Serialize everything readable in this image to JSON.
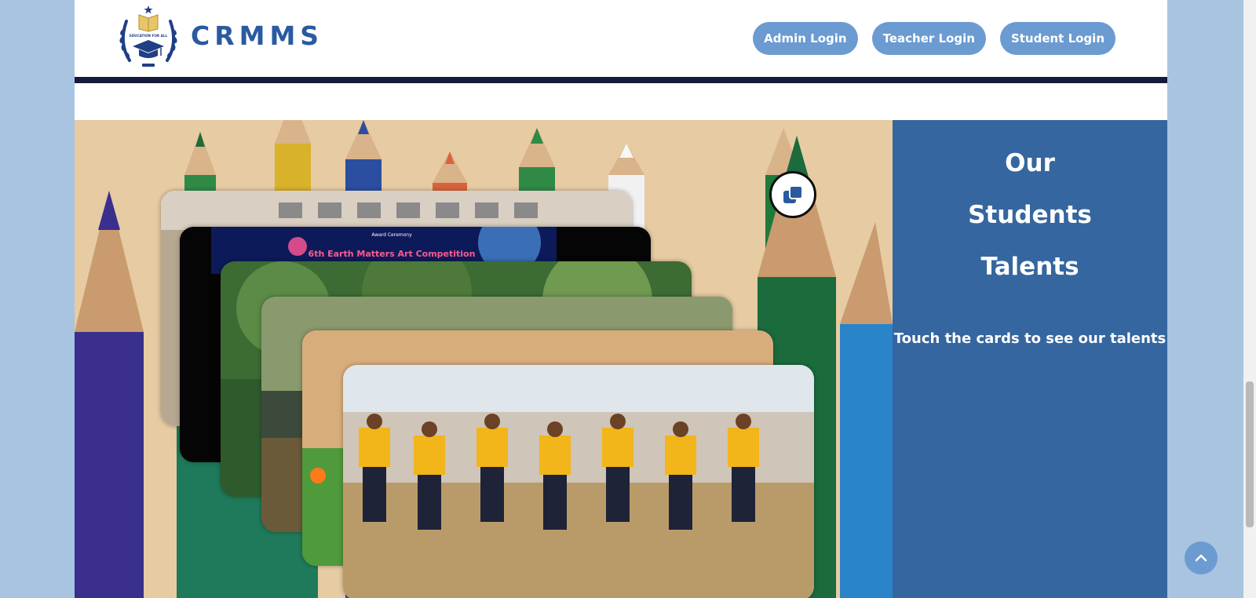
{
  "header": {
    "brand_name": "CRMMS",
    "logo_text": "EDUCATION FOR ALL",
    "nav_buttons": [
      {
        "label": "Admin Login"
      },
      {
        "label": "Teacher Login"
      },
      {
        "label": "Student Login"
      }
    ]
  },
  "talents": {
    "title_lines": [
      "Our",
      "Students",
      "Talents"
    ],
    "hint": "Touch the cards to see our talents",
    "cards": [
      {
        "name": "school-building-photo"
      },
      {
        "name": "award-ceremony-photo",
        "caption_top": "Award Ceremony",
        "caption": "6th Earth Matters Art Competition"
      },
      {
        "name": "garden-photo"
      },
      {
        "name": "painting-photo"
      },
      {
        "name": "football-photo"
      },
      {
        "name": "drill-exercise-photo"
      }
    ]
  },
  "colors": {
    "page_background": "#a8c4e0",
    "brand_blue": "#2a5aa0",
    "nav_button": "#6b9bd1",
    "header_rule": "#151b3d",
    "talent_panel": "#35669f"
  },
  "icons": {
    "swap": "stacked-cards-icon",
    "back_to_top": "chevron-up-icon"
  }
}
